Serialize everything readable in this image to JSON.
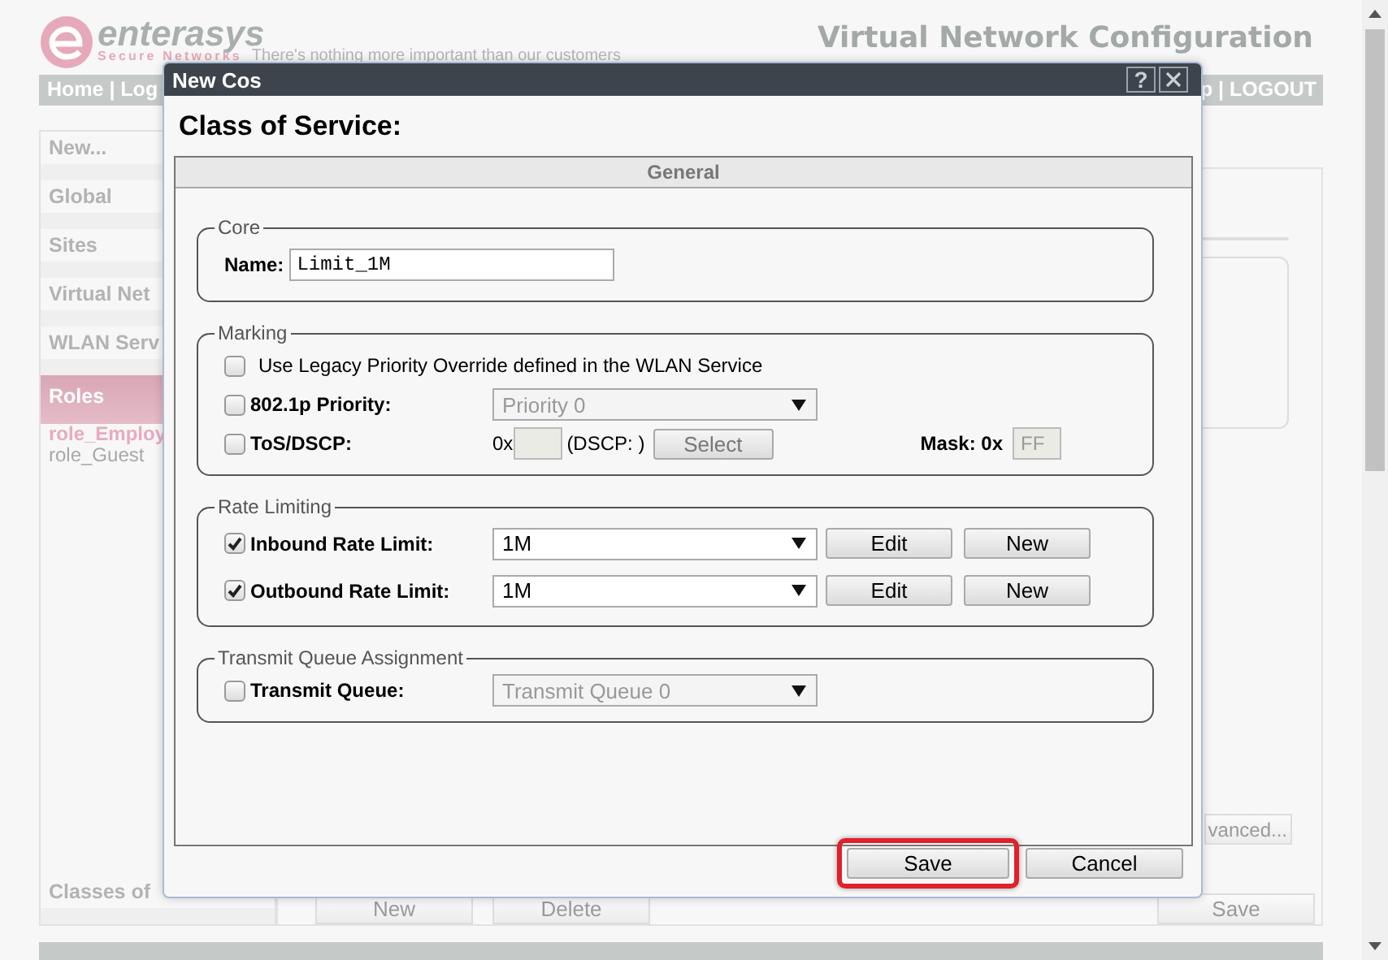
{
  "header": {
    "brand": "enterasys",
    "brand_sub": "Secure Networks",
    "tagline": "There's nothing more important than our customers",
    "app_title": "Virtual Network Configuration"
  },
  "nav": {
    "left": "Home | Log",
    "right": "p | LOGOUT"
  },
  "sidebar": {
    "items": [
      {
        "label": "New...",
        "selected": false
      },
      {
        "label": "Global",
        "selected": false
      },
      {
        "label": "Sites",
        "selected": false
      },
      {
        "label": "Virtual Net",
        "selected": false
      },
      {
        "label": "WLAN Serv",
        "selected": false
      },
      {
        "label": "Roles",
        "selected": true,
        "children": [
          {
            "label": "role_Employ",
            "selected": true
          },
          {
            "label": "role_Guest",
            "selected": false
          }
        ]
      }
    ],
    "bottom_items": [
      {
        "label": "Classes of",
        "selected": false
      }
    ]
  },
  "content": {
    "advanced_button": "vanced...",
    "left_buttons": [
      "New",
      "Delete"
    ],
    "save_button": "Save"
  },
  "dialog": {
    "title": "New Cos",
    "help_label": "?",
    "heading": "Class of Service:",
    "tab": "General",
    "sections": [
      {
        "legend": "Core",
        "rows": [
          {
            "kind": "text",
            "label": "Name:",
            "value": "Limit_1M"
          }
        ]
      },
      {
        "legend": "Marking",
        "rows": [
          {
            "kind": "check",
            "label": "Use Legacy Priority Override defined in the WLAN Service",
            "checked": false
          },
          {
            "kind": "select",
            "label": "802.1p Priority:",
            "checked": false,
            "value": "Priority 0",
            "disabled": true
          },
          {
            "kind": "tos",
            "label": "ToS/DSCP:",
            "checked": false,
            "prefix": "0x",
            "dscp": "(DSCP: )",
            "button": "Select",
            "mask_label": "Mask: 0x",
            "mask": "FF"
          }
        ]
      },
      {
        "legend": "Rate Limiting",
        "rows": [
          {
            "kind": "select",
            "label": "Inbound Rate Limit:",
            "checked": true,
            "value": "1M",
            "disabled": false,
            "buttons": [
              "Edit",
              "New"
            ]
          },
          {
            "kind": "select",
            "label": "Outbound Rate Limit:",
            "checked": true,
            "value": "1M",
            "disabled": false,
            "buttons": [
              "Edit",
              "New"
            ]
          }
        ]
      },
      {
        "legend": "Transmit Queue Assignment",
        "rows": [
          {
            "kind": "select",
            "label": "Transmit Queue:",
            "checked": false,
            "value": "Transmit Queue 0",
            "disabled": true
          }
        ]
      }
    ],
    "buttons": [
      {
        "label": "Save",
        "highlighted": true
      },
      {
        "label": "Cancel",
        "highlighted": false
      }
    ]
  }
}
